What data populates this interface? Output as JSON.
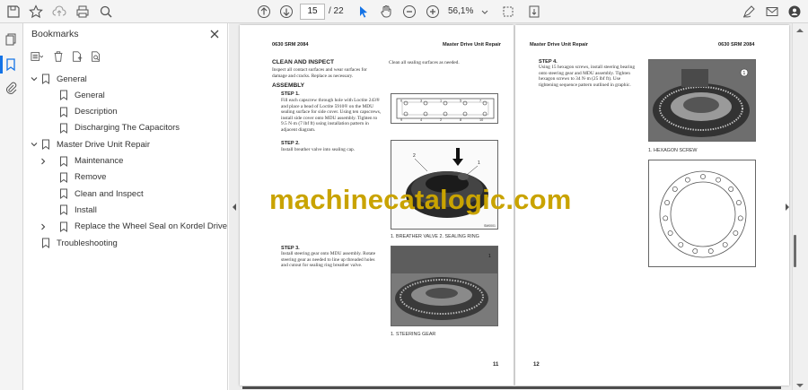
{
  "toolbar": {
    "current_page": "15",
    "total_pages": "/ 22",
    "zoom": "56,1%",
    "icons": [
      "save-icon",
      "star-icon",
      "upload-icon",
      "print-icon",
      "search-icon",
      "arrow-up-circle-icon",
      "arrow-down-circle-icon",
      "cursor-icon",
      "hand-icon",
      "zoom-out-icon",
      "zoom-in-icon",
      "fit-page-icon",
      "scroll-mode-icon",
      "sign-icon",
      "mail-icon",
      "account-icon"
    ]
  },
  "bookmarks": {
    "title": "Bookmarks",
    "items": [
      {
        "label": "General",
        "level": 0,
        "expanded": true
      },
      {
        "label": "General",
        "level": 1
      },
      {
        "label": "Description",
        "level": 1
      },
      {
        "label": "Discharging The Capacitors",
        "level": 1
      },
      {
        "label": "Master Drive Unit Repair",
        "level": 0,
        "expanded": true
      },
      {
        "label": "Maintenance",
        "level": 1,
        "collapsed": true
      },
      {
        "label": "Remove",
        "level": 1
      },
      {
        "label": "Clean and Inspect",
        "level": 1
      },
      {
        "label": "Install",
        "level": 1
      },
      {
        "label": "Replace the Wheel Seal on Kordel Drive Units",
        "level": 1,
        "collapsed": true
      },
      {
        "label": "Troubleshooting",
        "level": 0
      }
    ]
  },
  "page_left": {
    "doc_code": "0630 SRM 2084",
    "header_right": "Master Drive Unit Repair",
    "section_title": "CLEAN AND INSPECT",
    "intro": "Inspect all contact surfaces and wear surfaces for damage and cracks. Replace as necessary.",
    "right_note": "Clean all sealing surfaces as needed.",
    "subsection": "ASSEMBLY",
    "step1_title": "STEP 1.",
    "step1_text": "Fill each capscrew through hole with Loctite 243® and place a bead of Loctite 5910® on the MDU sealing surface for side cover. Using ten capscrews, install side cover onto MDU assembly. Tighten to 9.5 N·m (7 lbf ft) using installation pattern in adjacent diagram.",
    "step2_title": "STEP 2.",
    "step2_text": "Install breather valve into sealing cap.",
    "fig2_caption": "1.   BREATHER VALVE    2.   SEALING RING",
    "step3_title": "STEP 3.",
    "step3_text": "Install steering gear onto MDU assembly. Rotate steering gear as needed to line up threaded holes and cutout for sealing ring breather valve.",
    "fig3_caption": "1.   STEERING GEAR",
    "page_number": "11"
  },
  "page_right": {
    "header_left": "Master Drive Unit Repair",
    "doc_code": "0630 SRM 2084",
    "step4_title": "STEP 4.",
    "step4_text": "Using 15 hexagon screws, install steering bearing onto steering gear and MDU assembly. Tighten hexagon screws to 34 N·m (25 lbf ft). Use tightening sequence pattern outlined in graphic.",
    "fig4_caption": "1.   HEXAGON SCREW",
    "page_number": "12"
  },
  "watermark": "machinecatalogic.com",
  "colors": {
    "accent": "#1473e6",
    "watermark": "#c9a300",
    "doc_bg": "#ededed"
  }
}
